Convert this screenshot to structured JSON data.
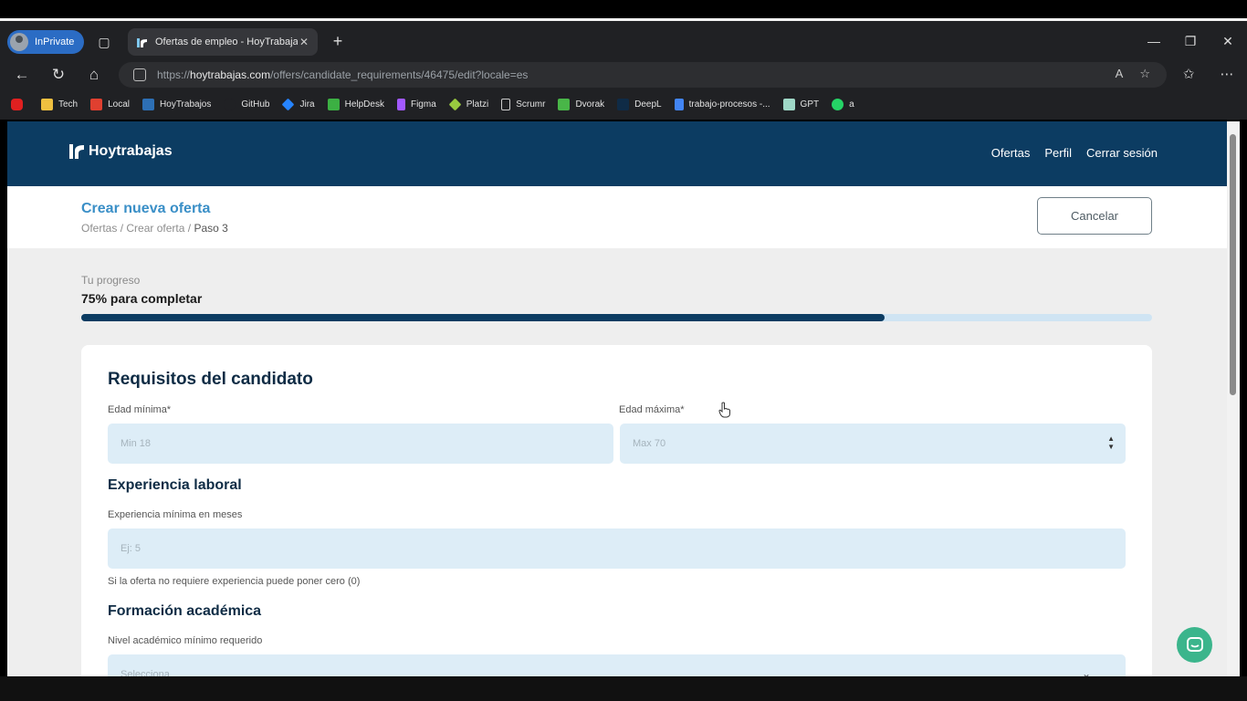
{
  "browser": {
    "inprivate_label": "InPrivate",
    "tab_title": "Ofertas de empleo - HoyTrabajas",
    "url_prefix": "https://",
    "url_host": "hoytrabajas.com",
    "url_path": "/offers/candidate_requirements/46475/edit?locale=es",
    "bookmarks": [
      {
        "label": "",
        "color": "#e02020"
      },
      {
        "label": "Tech",
        "color": "#f0c040"
      },
      {
        "label": "Local",
        "color": "#e04030"
      },
      {
        "label": "HoyTrabajos",
        "color": "#2d6fb5"
      },
      {
        "label": "GitHub",
        "color": "#202124"
      },
      {
        "label": "Jira",
        "color": "#2684ff"
      },
      {
        "label": "HelpDesk",
        "color": "#3cb043"
      },
      {
        "label": "Figma",
        "color": "#a259ff"
      },
      {
        "label": "Platzi",
        "color": "#98ca3f"
      },
      {
        "label": "Scrumr",
        "color": "#cccccc"
      },
      {
        "label": "Dvorak",
        "color": "#49b648"
      },
      {
        "label": "DeepL",
        "color": "#0f2b46"
      },
      {
        "label": "trabajo-procesos -...",
        "color": "#4285f4"
      },
      {
        "label": "GPT",
        "color": "#9fd8c7"
      },
      {
        "label": "a",
        "color": "#25d366"
      }
    ]
  },
  "site": {
    "logo_text": "Hoytrabajas",
    "nav": {
      "offers": "Ofertas",
      "profile": "Perfil",
      "logout": "Cerrar sesión"
    },
    "accent": "#3a8fc7",
    "header_color": "#0c3c62"
  },
  "subheader": {
    "title": "Crear nueva oferta",
    "breadcrumb_1": "Ofertas",
    "breadcrumb_2": "Crear oferta",
    "breadcrumb_3": "Paso 3",
    "separator": "/",
    "cancel_label": "Cancelar"
  },
  "progress": {
    "label": "Tu progreso",
    "value_text": "75% para completar",
    "fraction": 0.75
  },
  "form": {
    "title": "Requisitos del candidato",
    "min_age_label": "Edad mínima*",
    "min_age_placeholder": "Min 18",
    "max_age_label": "Edad máxima*",
    "max_age_placeholder": "Max 70",
    "experience_title": "Experiencia laboral",
    "experience_label": "Experiencia mínima en meses",
    "experience_placeholder": "Ej: 5",
    "experience_hint": "Si la oferta no requiere experiencia puede poner cero (0)",
    "education_title": "Formación académica",
    "education_label": "Nivel académico mínimo requerido",
    "education_placeholder": "Selecciona"
  }
}
